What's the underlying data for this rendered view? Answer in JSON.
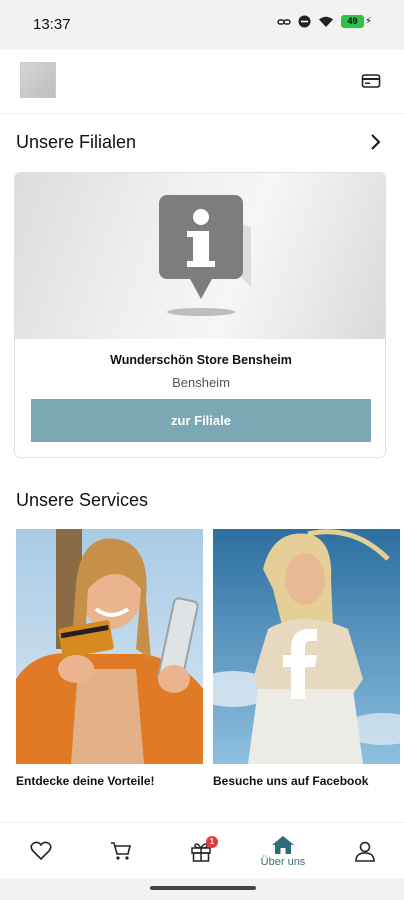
{
  "status_bar": {
    "time": "13:37",
    "battery_level": "49",
    "icons": [
      "link-icon",
      "do-not-disturb-icon",
      "wifi-icon",
      "battery-icon"
    ]
  },
  "header": {
    "logo": "store-logo",
    "card_icon": "card-icon"
  },
  "stores_section": {
    "title": "Unsere Filialen",
    "store": {
      "name": "Wunderschön Store Bensheim",
      "city": "Bensheim",
      "button_label": "zur Filiale",
      "image_icon": "info-pin-icon"
    }
  },
  "services_section": {
    "title": "Unsere Services",
    "items": [
      {
        "label": "Entdecke deine Vorteile!",
        "image": "woman-with-card-photo"
      },
      {
        "label": "Besuche uns auf Facebook",
        "image": "facebook-photo"
      }
    ]
  },
  "bottom_nav": {
    "items": [
      {
        "icon": "heart-icon",
        "label": ""
      },
      {
        "icon": "cart-icon",
        "label": ""
      },
      {
        "icon": "gift-icon",
        "label": "",
        "badge": "1"
      },
      {
        "icon": "home-icon",
        "label": "Über uns",
        "active": true
      },
      {
        "icon": "user-icon",
        "label": ""
      }
    ]
  },
  "colors": {
    "accent": "#7ba8b4",
    "nav_active": "#2f6b78",
    "badge": "#e53935"
  }
}
